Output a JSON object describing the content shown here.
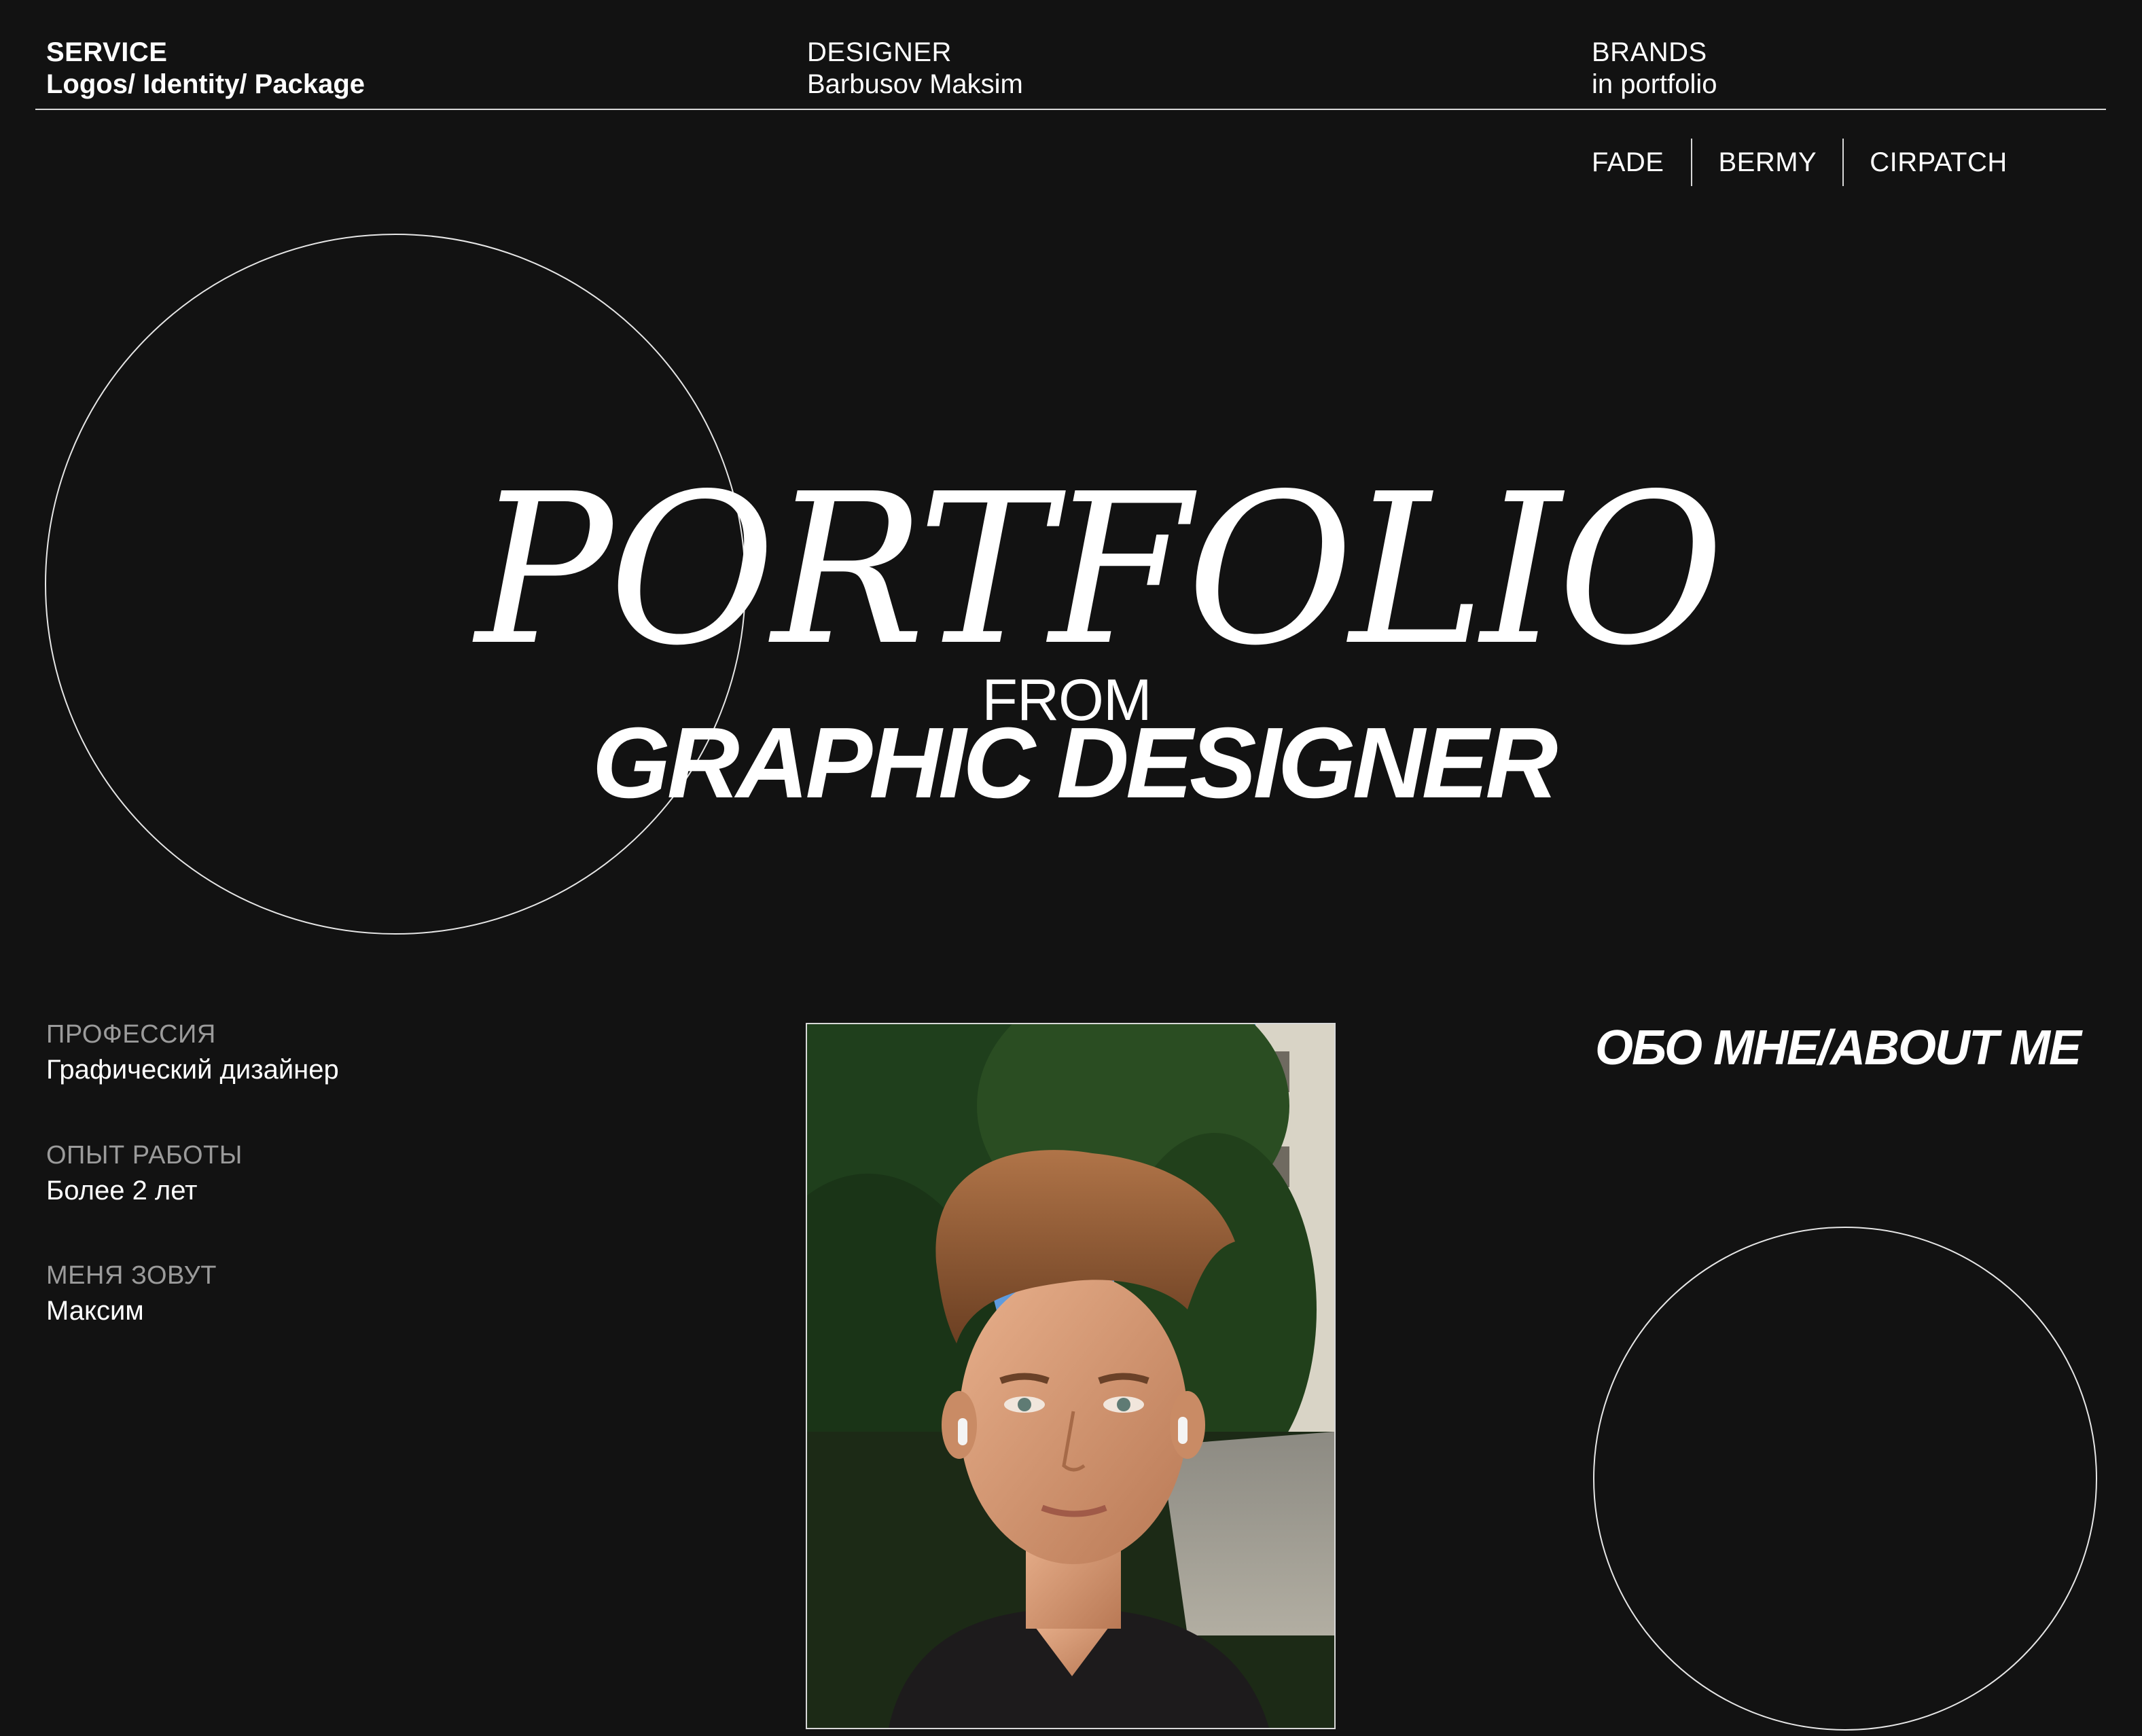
{
  "header": {
    "service": {
      "title": "SERVICE",
      "value": "Logos/ Identity/ Package"
    },
    "designer": {
      "title": "DESIGNER",
      "value": "Barbusov Maksim"
    },
    "brands": {
      "title": "BRANDS",
      "value": "in portfolio"
    }
  },
  "brands_nav": [
    "FADE",
    "BERMY",
    "CIRPATCH"
  ],
  "hero": {
    "word": "PORTFOLIO",
    "from": "FROM",
    "role": "GRAPHIC DESIGNER"
  },
  "info": [
    {
      "label": "ПРОФЕССИЯ",
      "value": "Графический дизайнер"
    },
    {
      "label": "ОПЫТ РАБОТЫ",
      "value": "Более 2 лет"
    },
    {
      "label": "МЕНЯ ЗОВУТ",
      "value": "Максим"
    }
  ],
  "about_heading": "ОБО МНЕ/ABOUT ME",
  "colors": {
    "background": "#121212",
    "text": "#ffffff",
    "muted": "#9b9b9b",
    "line": "#d8d8d8"
  }
}
